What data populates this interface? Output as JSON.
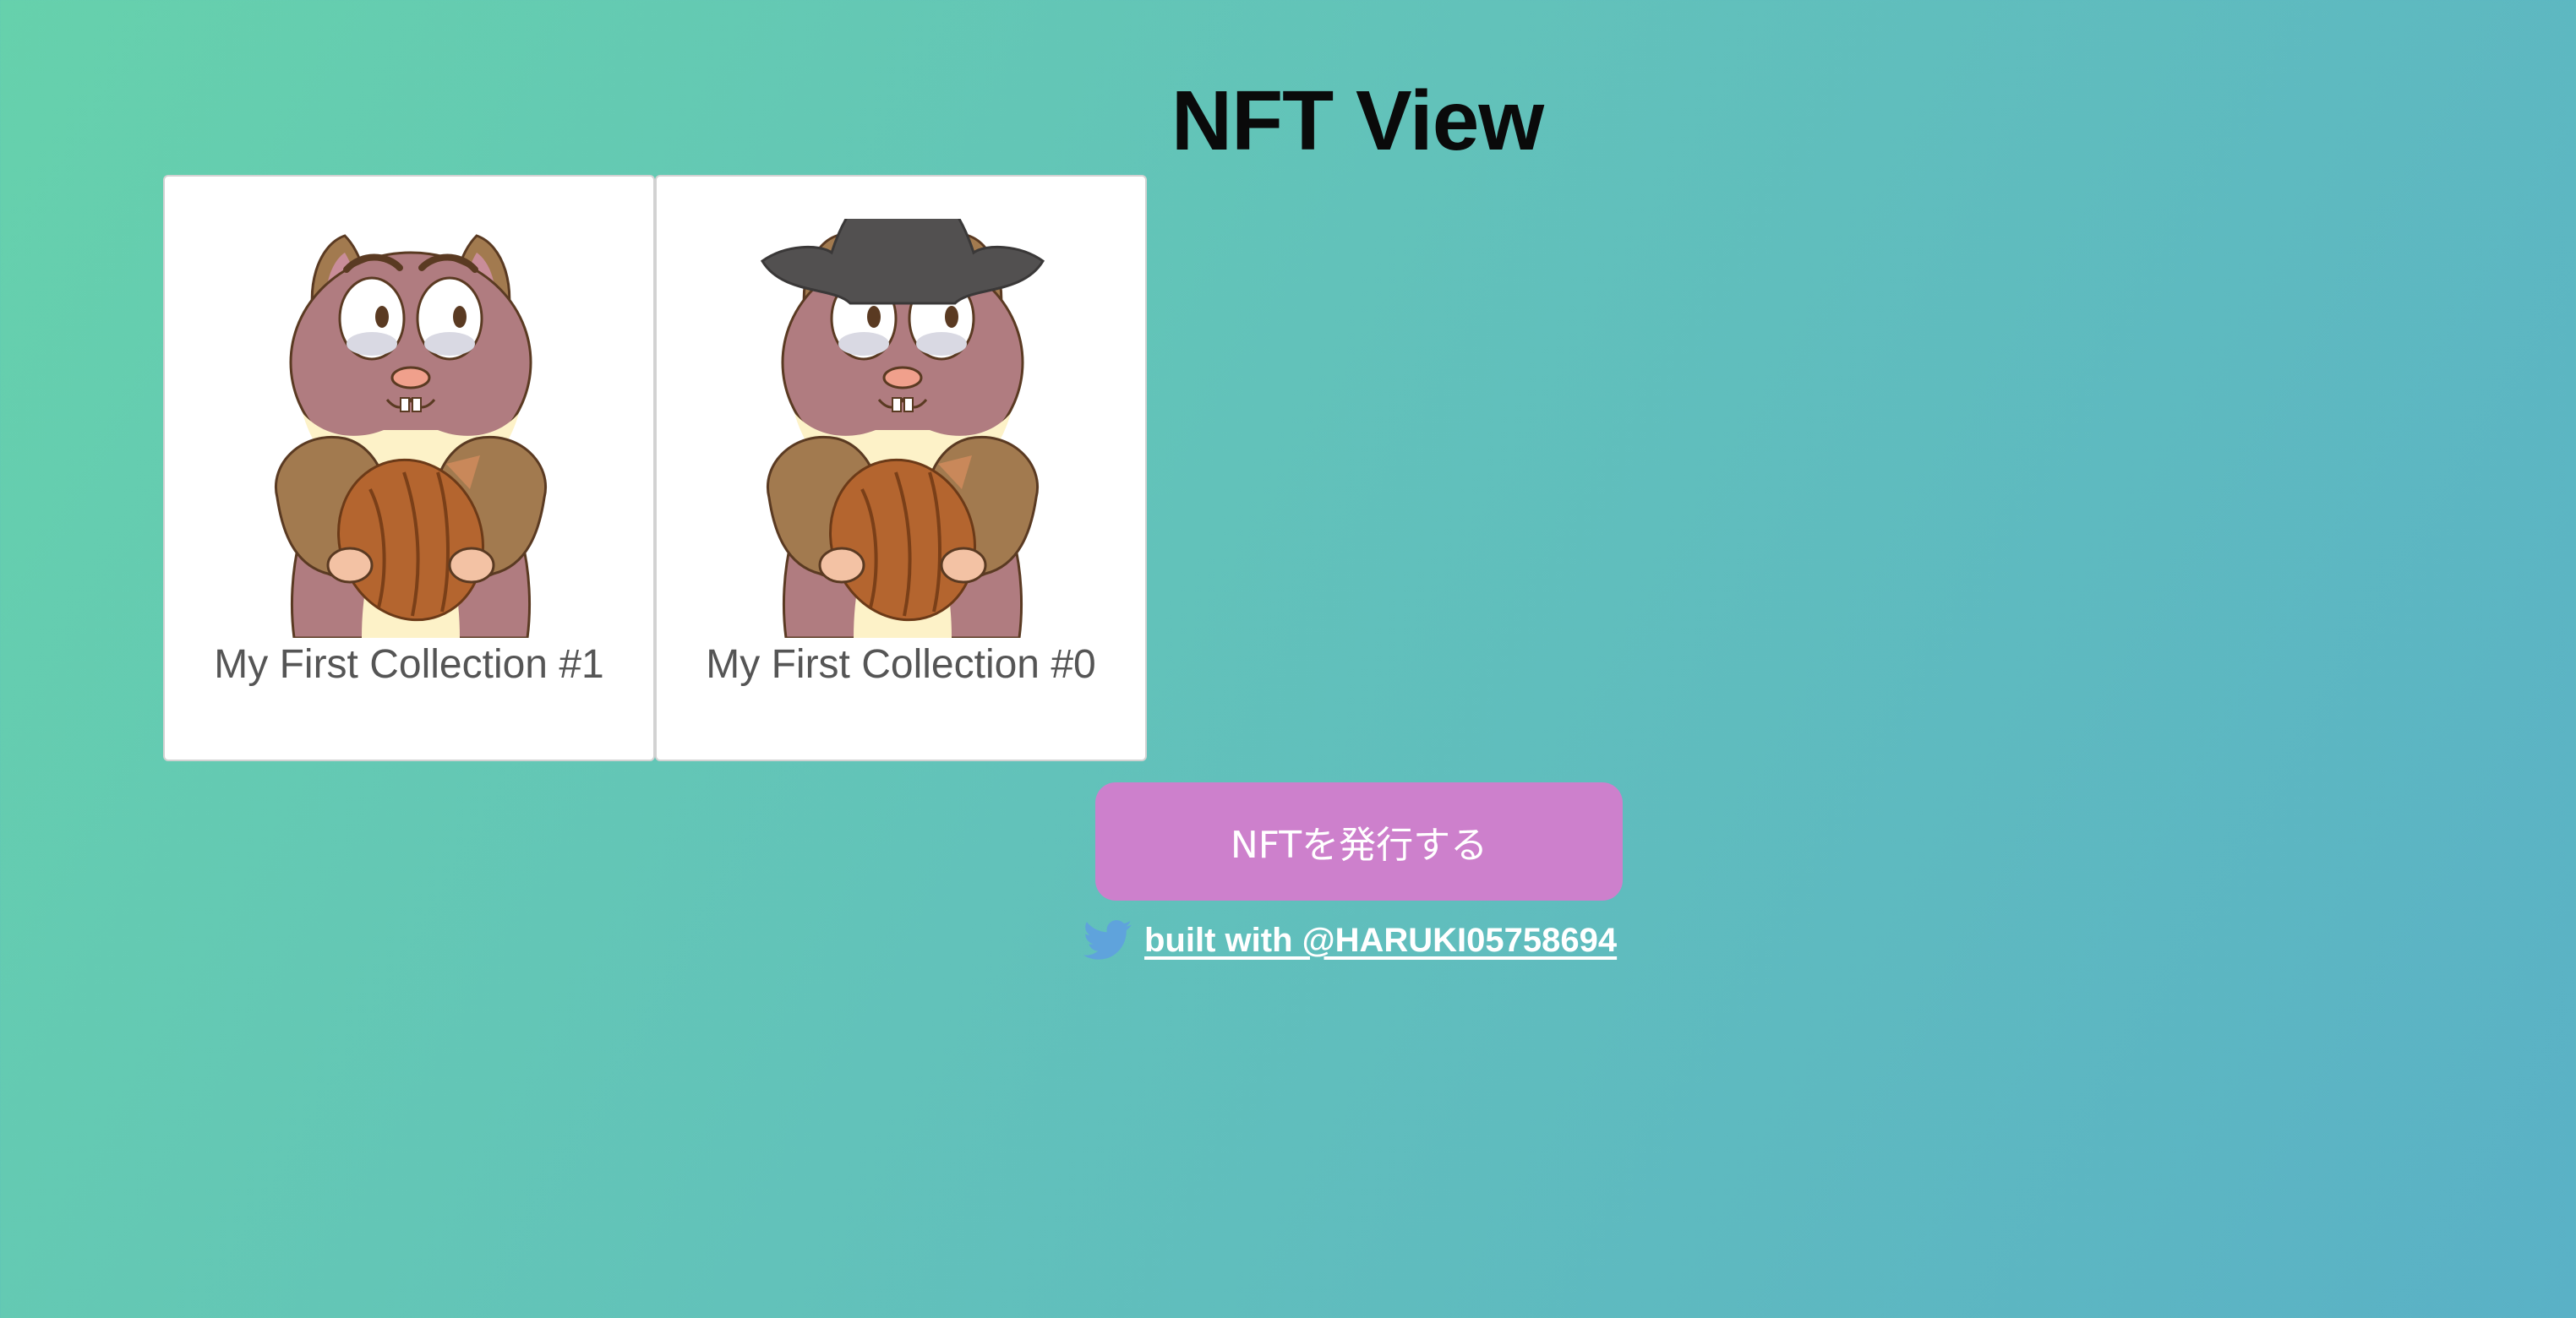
{
  "header": {
    "title": "NFT View"
  },
  "gallery": {
    "items": [
      {
        "title": "My First Collection #1",
        "image": "squirrel-with-nut",
        "hat": false
      },
      {
        "title": "My First Collection #0",
        "image": "squirrel-with-nut-pirate-hat",
        "hat": true
      }
    ]
  },
  "mint": {
    "label": "NFTを発行する",
    "color": "#cd80cc"
  },
  "footer": {
    "icon": "twitter-icon",
    "link_text": "built with @HARUKI05758694",
    "icon_color": "#5fa3dc"
  },
  "colors": {
    "background_start": "#66d1ac",
    "background_end": "#5ab1c6",
    "card_background": "#ffffff"
  }
}
